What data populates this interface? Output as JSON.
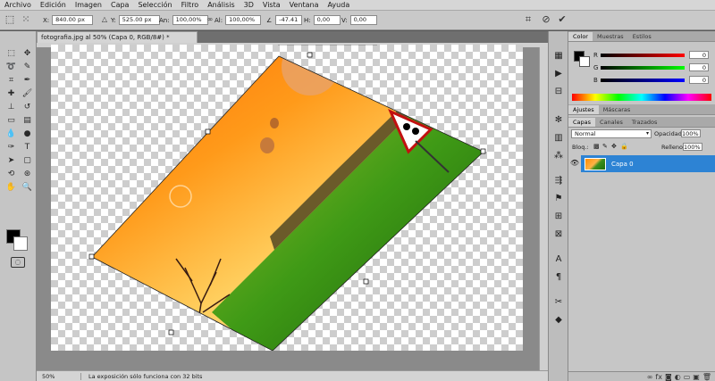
{
  "menu": [
    "Archivo",
    "Edición",
    "Imagen",
    "Capa",
    "Selección",
    "Filtro",
    "Análisis",
    "3D",
    "Vista",
    "Ventana",
    "Ayuda"
  ],
  "options": {
    "x_label": "X:",
    "x_value": "840.00 px",
    "y_label": "Y:",
    "y_value": "525.00 px",
    "w_label": "An:",
    "w_value": "100,00%",
    "h_label": "Al:",
    "h_value": "100,00%",
    "angle_label": "∠",
    "angle_value": "-47.41",
    "hskew_label": "H:",
    "hskew_value": "0,00",
    "vskew_label": "V:",
    "vskew_value": "0,00"
  },
  "document": {
    "tab_title": "fotografia.jpg al 50% (Capa 0, RGB/8#) *"
  },
  "status": {
    "zoom": "50%",
    "message": "La exposición sólo funciona con 32 bits"
  },
  "color_panel": {
    "tabs": [
      "Color",
      "Muestras",
      "Estilos"
    ],
    "channels": [
      {
        "label": "R",
        "value": "0"
      },
      {
        "label": "G",
        "value": "0"
      },
      {
        "label": "B",
        "value": "0"
      }
    ]
  },
  "adjust_tabs": [
    "Ajustes",
    "Máscaras"
  ],
  "layers_panel": {
    "tabs": [
      "Capas",
      "Canales",
      "Trazados"
    ],
    "blend_mode": "Normal",
    "opacity_label": "Opacidad:",
    "opacity_value": "100%",
    "lock_label": "Bloq.:",
    "fill_label": "Relleno:",
    "fill_value": "100%",
    "layers": [
      {
        "name": "Capa 0"
      }
    ]
  },
  "colors": {
    "accent": "#2d83d4",
    "background": "#595959"
  }
}
